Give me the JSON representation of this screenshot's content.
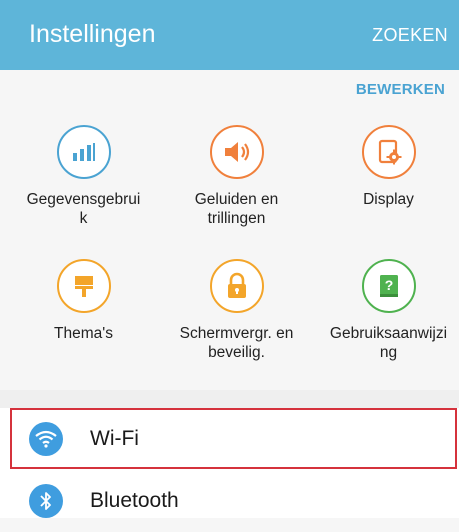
{
  "header": {
    "title": "Instellingen",
    "search_label": "ZOEKEN"
  },
  "edit_label": "BEWERKEN",
  "quick_settings": [
    {
      "label_line1": "Gegevensgebrui",
      "label_line2": "k",
      "icon": "data-usage-icon",
      "color": "#4aa3d2"
    },
    {
      "label_line1": "Geluiden en",
      "label_line2": "trillingen",
      "icon": "volume-icon",
      "color": "#f0803c"
    },
    {
      "label_line1": "Display",
      "label_line2": "",
      "icon": "display-settings-icon",
      "color": "#f0803c"
    },
    {
      "label_line1": "Thema's",
      "label_line2": "",
      "icon": "theme-brush-icon",
      "color": "#f3a52a"
    },
    {
      "label_line1": "Schermvergr. en",
      "label_line2": "beveilig.",
      "icon": "lock-icon",
      "color": "#f3a52a"
    },
    {
      "label_line1": "Gebruiksaanwijzi",
      "label_line2": "ng",
      "icon": "user-manual-icon",
      "color": "#4fb24f"
    }
  ],
  "list": [
    {
      "label": "Wi-Fi",
      "icon": "wifi-icon",
      "selected": true,
      "color": "#3f9ddf"
    },
    {
      "label": "Bluetooth",
      "icon": "bluetooth-icon",
      "selected": false,
      "color": "#3f9ddf"
    }
  ]
}
